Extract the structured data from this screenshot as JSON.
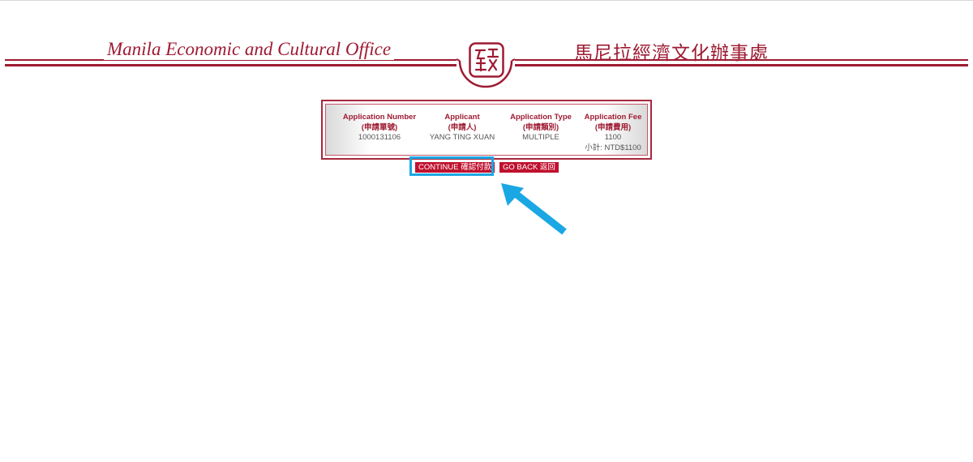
{
  "header": {
    "title_en": "Manila Economic and Cultural Office",
    "title_zh": "馬尼拉經濟文化辦事處",
    "seal_glyph": "經文",
    "brand_color": "#9e1b32"
  },
  "summary": {
    "columns": [
      {
        "label": "Application Number",
        "label_zh": "(申請單號)",
        "value": "1000131106"
      },
      {
        "label": "Applicant",
        "label_zh": "(申請人)",
        "value": "YANG TING XUAN"
      },
      {
        "label": "Application Type",
        "label_zh": "(申請類別)",
        "value": "MULTIPLE"
      },
      {
        "label": "Application Fee",
        "label_zh": "(申請費用)",
        "value": "1100"
      }
    ],
    "subtotal": "小計: NTD$1100"
  },
  "actions": {
    "continue_label": "CONTINUE 確認付款",
    "back_label": "GO BACK 返回",
    "button_color": "#c0112f",
    "highlight_color": "#1ba7e3"
  }
}
